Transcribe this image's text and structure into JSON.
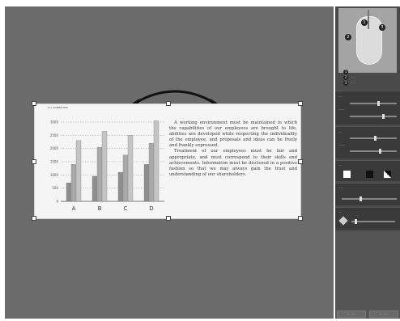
{
  "document": {
    "header": "4.1 LOREM INC",
    "paragraphs": [
      "A working environment must be maintained in which the capabilities of our employees are brought to life, abilities are developed while respecting the individuality of the employee, and proposals and ideas can be freely and frankly expressed.",
      "Treatment of our employees must be fair and appropriate, and must correspond to their skills and achievements. Information must be disclosed in a positive fashion so that we may always gain the trust and understanding of our shareholders."
    ]
  },
  "chart_data": {
    "type": "bar",
    "categories": [
      "A",
      "B",
      "C",
      "D"
    ],
    "y_ticks": [
      "3000",
      "2500",
      "2000",
      "1500",
      "1000",
      "500",
      "0"
    ],
    "ylim": [
      0,
      3000
    ],
    "grid": true,
    "series": [
      {
        "values": [
          700,
          950,
          1100,
          1400
        ],
        "color": "#8e8e8e"
      },
      {
        "values": [
          1400,
          2050,
          1750,
          2200
        ],
        "color": "#a9a9a9"
      },
      {
        "values": [
          2300,
          2650,
          2500,
          3050
        ],
        "color": "#c4c4c4"
      }
    ]
  },
  "sidebar": {
    "callouts": [
      "1",
      "2",
      "3"
    ],
    "panels": {
      "p1_labels": [
        "···",
        "······"
      ],
      "p2_labels": [
        "···",
        "······"
      ],
      "p3_label": "···",
      "p4_label": "····",
      "p5_label": "···"
    },
    "buttons": [
      "···  ····",
      "···  ····"
    ]
  },
  "colors": {
    "workspace": "#6b6b6b",
    "sidebar": "#4a4a4a"
  }
}
